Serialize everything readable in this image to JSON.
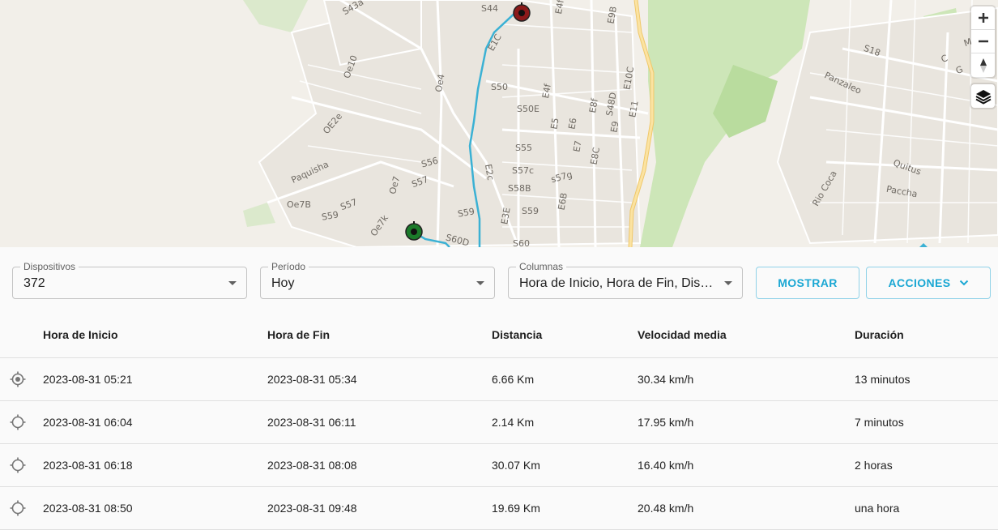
{
  "map": {
    "labels": [
      "S43a",
      "S44",
      "E1C",
      "E4f",
      "E9B",
      "Oe10",
      "Oe4",
      "S50",
      "E4f",
      "E10C",
      "S18",
      "Panzaleo",
      "OE2e",
      "S50E",
      "E5",
      "E6",
      "E8f",
      "S48D",
      "E9",
      "E11",
      "Paquisha",
      "S56",
      "S55",
      "E7",
      "E8C",
      "Quitus",
      "Oe7",
      "S57",
      "E2c",
      "S57c",
      "s57g",
      "S58B",
      "Rio Coca",
      "Paccha",
      "Oe7B",
      "S57",
      "S59",
      "E6B",
      "S59",
      "S59",
      "Oe7k",
      "S60D",
      "S60",
      "E3E",
      "C",
      "G",
      "M",
      "E"
    ],
    "controls": {
      "zoom_in": "zoom-in-icon",
      "zoom_out": "zoom-out-icon",
      "compass": "compass-icon",
      "layers": "layers-icon"
    },
    "colors": {
      "route": "#3bb1d4",
      "start_marker": "#1b7a2a",
      "end_marker": "#8b1a1a",
      "road_major": "#f7d98a",
      "park": "#c5e3b0"
    }
  },
  "toolbar": {
    "devices": {
      "label": "Dispositivos",
      "value": "372"
    },
    "period": {
      "label": "Período",
      "value": "Hoy"
    },
    "columns": {
      "label": "Columnas",
      "value": "Hora de Inicio, Hora de Fin, Distancia, Velocidad media, Duración"
    },
    "show_button": "MOSTRAR",
    "actions_button": "ACCIONES"
  },
  "table": {
    "headers": [
      "Hora de Inicio",
      "Hora de Fin",
      "Distancia",
      "Velocidad media",
      "Duración"
    ],
    "rows": [
      {
        "start": "2023-08-31 05:21",
        "end": "2023-08-31 05:34",
        "distance": "6.66 Km",
        "speed": "30.34 km/h",
        "duration": "13 minutos",
        "selected": true
      },
      {
        "start": "2023-08-31 06:04",
        "end": "2023-08-31 06:11",
        "distance": "2.14 Km",
        "speed": "17.95 km/h",
        "duration": "7 minutos",
        "selected": false
      },
      {
        "start": "2023-08-31 06:18",
        "end": "2023-08-31 08:08",
        "distance": "30.07 Km",
        "speed": "16.40 km/h",
        "duration": "2 horas",
        "selected": false
      },
      {
        "start": "2023-08-31 08:50",
        "end": "2023-08-31 09:48",
        "distance": "19.69 Km",
        "speed": "20.48 km/h",
        "duration": "una hora",
        "selected": false
      }
    ]
  },
  "accent": "#1aa7d3"
}
